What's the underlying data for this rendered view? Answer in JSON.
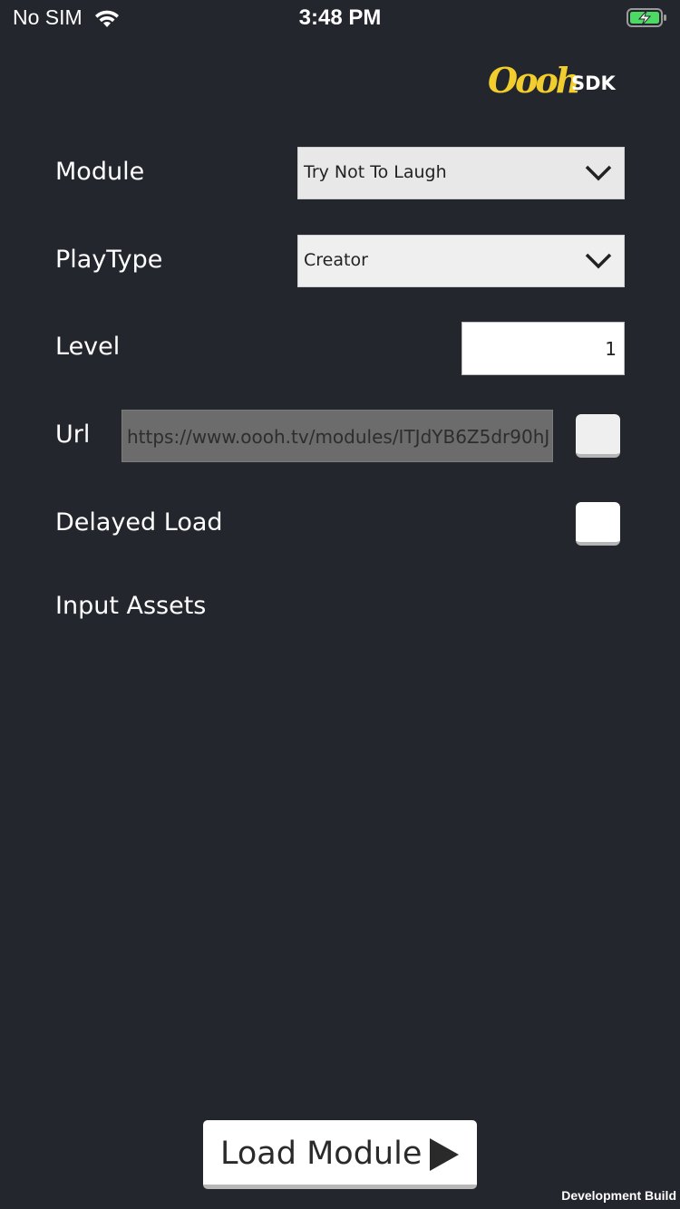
{
  "status_bar": {
    "carrier": "No SIM",
    "time": "3:48 PM",
    "wifi_icon": "wifi-icon",
    "battery_icon": "battery-charging-icon",
    "battery_color": "#4cd964"
  },
  "logo": {
    "wordmark": "Oooh",
    "suffix": "SDK",
    "brand_color": "#f1cd2d"
  },
  "form": {
    "module": {
      "label": "Module",
      "value": "Try Not To Laugh",
      "icon": "chevron-down-icon"
    },
    "play_type": {
      "label": "PlayType",
      "value": "Creator",
      "icon": "chevron-down-icon"
    },
    "level": {
      "label": "Level",
      "value": "1"
    },
    "url": {
      "label": "Url",
      "value": "https://www.oooh.tv/modules/ITJdYB6Z5dr90hJ",
      "checked": false
    },
    "delayed_load": {
      "label": "Delayed Load",
      "checked": false
    },
    "input_assets": {
      "label": "Input Assets"
    }
  },
  "load_button": {
    "label": "Load Module",
    "icon": "play-icon"
  },
  "footer": {
    "build_label": "Development Build"
  },
  "colors": {
    "background": "#24262e",
    "text": "#ffffff"
  }
}
